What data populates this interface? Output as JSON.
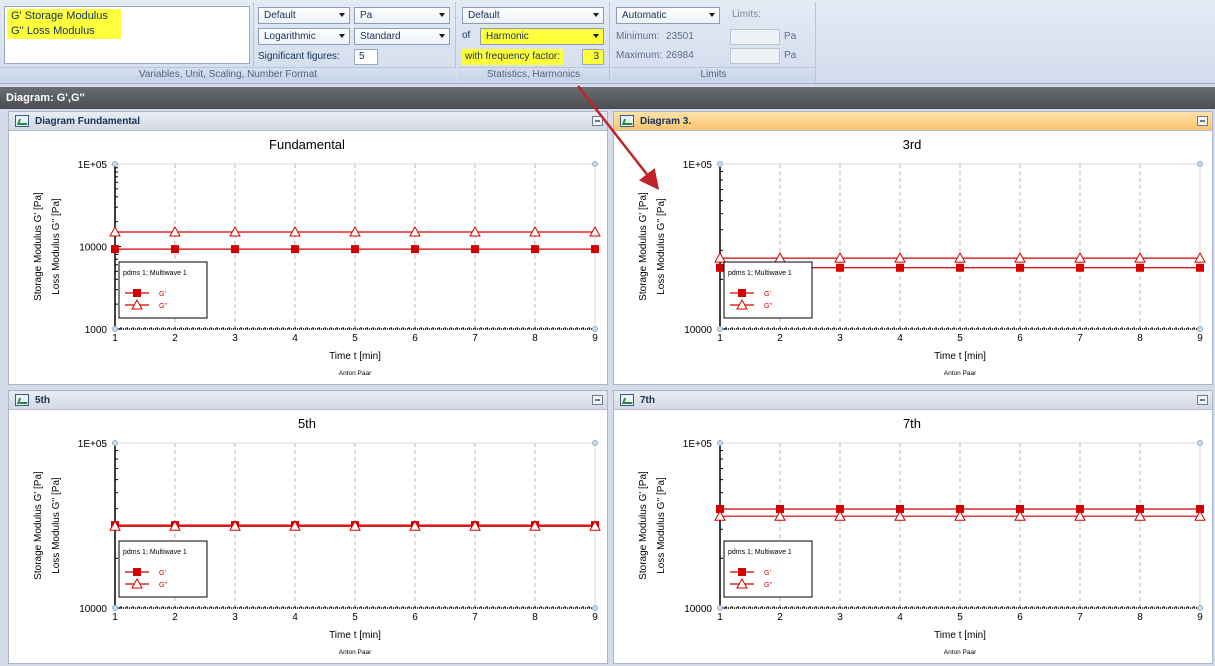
{
  "ribbon": {
    "variables": {
      "items": [
        "G'  Storage Modulus",
        "G''  Loss Modulus"
      ],
      "group_label": "Variables, Unit, Scaling, Number Format"
    },
    "format": {
      "preset": "Default",
      "unit": "Pa",
      "scaling": "Logarithmic",
      "notation": "Standard",
      "sig_fig_label": "Significant figures:",
      "sig_fig_value": "5"
    },
    "statistics": {
      "preset": "Default",
      "of_label": "of",
      "harmonic": "Harmonic",
      "freq_label": "with frequency factor:",
      "freq_value": "3",
      "group_label": "Statistics, Harmonics"
    },
    "limits": {
      "mode": "Automatic",
      "limits_label": "Limits:",
      "min_label": "Minimum:",
      "min_value": "23501",
      "max_label": "Maximum:",
      "max_value": "26984",
      "unit1": "Pa",
      "unit2": "Pa",
      "group_label": "Limits"
    }
  },
  "diagram_title": "Diagram: G',G''",
  "panes": [
    {
      "header": "Diagram Fundamental",
      "active": false
    },
    {
      "header": "Diagram 3.",
      "active": true
    },
    {
      "header": "5th",
      "active": false
    },
    {
      "header": "7th",
      "active": false
    }
  ],
  "colors": {
    "series": "#d40000",
    "accent": "#ffff3c",
    "annotation_arrow": "#c0242a"
  },
  "chart_data": [
    {
      "type": "line",
      "title": "Fundamental",
      "xlabel": "Time t [min]",
      "ylabel1": "Storage Modulus G' [Pa]",
      "ylabel2": "Loss Modulus G'' [Pa]",
      "yscale": "log",
      "ylim": [
        1000,
        100000
      ],
      "ytick_labels": [
        "1E+05",
        "10000",
        "1000"
      ],
      "xlim": [
        1,
        9
      ],
      "x": [
        1,
        2,
        3,
        4,
        5,
        6,
        7,
        8,
        9
      ],
      "series": [
        {
          "name": "G'",
          "marker": "filled-square",
          "values": [
            9300,
            9300,
            9300,
            9300,
            9300,
            9300,
            9300,
            9300,
            9300
          ]
        },
        {
          "name": "G''",
          "marker": "open-triangle",
          "values": [
            15000,
            15000,
            15000,
            15000,
            15000,
            15000,
            15000,
            15000,
            15000
          ]
        }
      ],
      "legend_title": "pdms 1; Multiwave 1",
      "legend_loc": "lower-left",
      "footer": "Anton Paar"
    },
    {
      "type": "line",
      "title": "3rd",
      "xlabel": "Time t [min]",
      "ylabel1": "Storage Modulus G' [Pa]",
      "ylabel2": "Loss Modulus G'' [Pa]",
      "yscale": "log",
      "ylim": [
        10000,
        100000
      ],
      "ytick_labels": [
        "1E+05",
        "10000"
      ],
      "xlim": [
        1,
        9
      ],
      "x": [
        1,
        2,
        3,
        4,
        5,
        6,
        7,
        8,
        9
      ],
      "series": [
        {
          "name": "G'",
          "marker": "filled-square",
          "values": [
            23500,
            23500,
            23500,
            23500,
            23500,
            23500,
            23500,
            23500,
            23500
          ]
        },
        {
          "name": "G''",
          "marker": "open-triangle",
          "values": [
            26900,
            26900,
            26900,
            26900,
            26900,
            26900,
            26900,
            26900,
            26900
          ]
        }
      ],
      "legend_title": "pdms 1; Multiwave 1",
      "legend_loc": "lower-left",
      "footer": "Anton Paar"
    },
    {
      "type": "line",
      "title": "5th",
      "xlabel": "Time t [min]",
      "ylabel1": "Storage Modulus G' [Pa]",
      "ylabel2": "Loss Modulus G'' [Pa]",
      "yscale": "log",
      "ylim": [
        10000,
        100000
      ],
      "ytick_labels": [
        "1E+05",
        "10000"
      ],
      "xlim": [
        1,
        9
      ],
      "x": [
        1,
        2,
        3,
        4,
        5,
        6,
        7,
        8,
        9
      ],
      "series": [
        {
          "name": "G'",
          "marker": "filled-square",
          "values": [
            31800,
            31800,
            31800,
            31800,
            31800,
            31800,
            31800,
            31800,
            31800
          ]
        },
        {
          "name": "G''",
          "marker": "open-triangle",
          "values": [
            31300,
            31300,
            31300,
            31300,
            31300,
            31300,
            31300,
            31300,
            31300
          ]
        }
      ],
      "legend_title": "pdms 1; Multiwave 1",
      "legend_loc": "lower-left",
      "footer": "Anton Paar"
    },
    {
      "type": "line",
      "title": "7th",
      "xlabel": "Time t [min]",
      "ylabel1": "Storage Modulus G' [Pa]",
      "ylabel2": "Loss Modulus G'' [Pa]",
      "yscale": "log",
      "ylim": [
        10000,
        100000
      ],
      "ytick_labels": [
        "1E+05",
        "10000"
      ],
      "xlim": [
        1,
        9
      ],
      "x": [
        1,
        2,
        3,
        4,
        5,
        6,
        7,
        8,
        9
      ],
      "series": [
        {
          "name": "G'",
          "marker": "filled-square",
          "values": [
            39800,
            39800,
            39800,
            39800,
            39800,
            39800,
            39800,
            39800,
            39800
          ]
        },
        {
          "name": "G''",
          "marker": "open-triangle",
          "values": [
            36000,
            36000,
            36000,
            36000,
            36000,
            36000,
            36000,
            36000,
            36000
          ]
        }
      ],
      "legend_title": "pdms 1; Multiwave 1",
      "legend_loc": "lower-left",
      "footer": "Anton Paar"
    }
  ]
}
